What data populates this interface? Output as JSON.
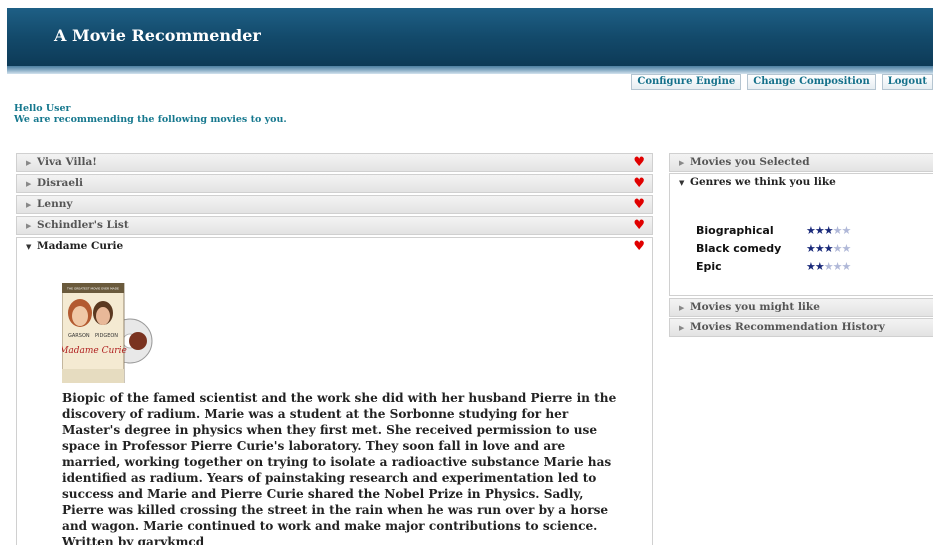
{
  "app": {
    "title": "A Movie Recommender"
  },
  "nav": [
    {
      "label": "Configure Engine"
    },
    {
      "label": "Change Composition"
    },
    {
      "label": "Logout"
    }
  ],
  "greeting": {
    "line1": "Hello User",
    "line2": "We are recommending the following movies to you."
  },
  "movies": [
    {
      "title": "Viva Villa!",
      "favorite": true
    },
    {
      "title": "Disraeli",
      "favorite": true
    },
    {
      "title": "Lenny",
      "favorite": true
    },
    {
      "title": "Schindler's List",
      "favorite": true
    },
    {
      "title": "Madame Curie",
      "favorite": true,
      "expanded": true
    }
  ],
  "expanded_movie": {
    "poster": {
      "top_text": "THE GREATEST MOVIE EVER MADE",
      "actor1": "GARSON",
      "actor2": "PIDGEON",
      "film_title": "Madame Curie"
    },
    "description": "Biopic of the famed scientist and the work she did with her husband Pierre in the discovery of radium. Marie was a student at the Sorbonne studying for her Master's degree in physics when they first met. She received permission to use space in Professor Pierre Curie's laboratory. They soon fall in love and are married, working together on trying to isolate a radioactive substance Marie has identified as radium. Years of painstaking research and experimentation led to success and Marie and Pierre Curie shared the Nobel Prize in Physics. Sadly, Pierre was killed crossing the street in the rain when he was run over by a horse and wagon. Marie continued to work and make major contributions to science. Written by garykmcd"
  },
  "side_panels": {
    "selected": "Movies you Selected",
    "genres": "Genres we think you like",
    "might_like": "Movies you might like",
    "history": "Movies Recommendation History"
  },
  "genres": [
    {
      "name": "Biographical",
      "rating": 3,
      "max": 5
    },
    {
      "name": "Black comedy",
      "rating": 3,
      "max": 5
    },
    {
      "name": "Epic",
      "rating": 2,
      "max": 5
    }
  ],
  "colors": {
    "header_dark": "#0d3a57",
    "accent_teal": "#16788e",
    "heart": "#e00000",
    "star_on": "#1a2a7a",
    "star_off": "#b0b8d8"
  }
}
